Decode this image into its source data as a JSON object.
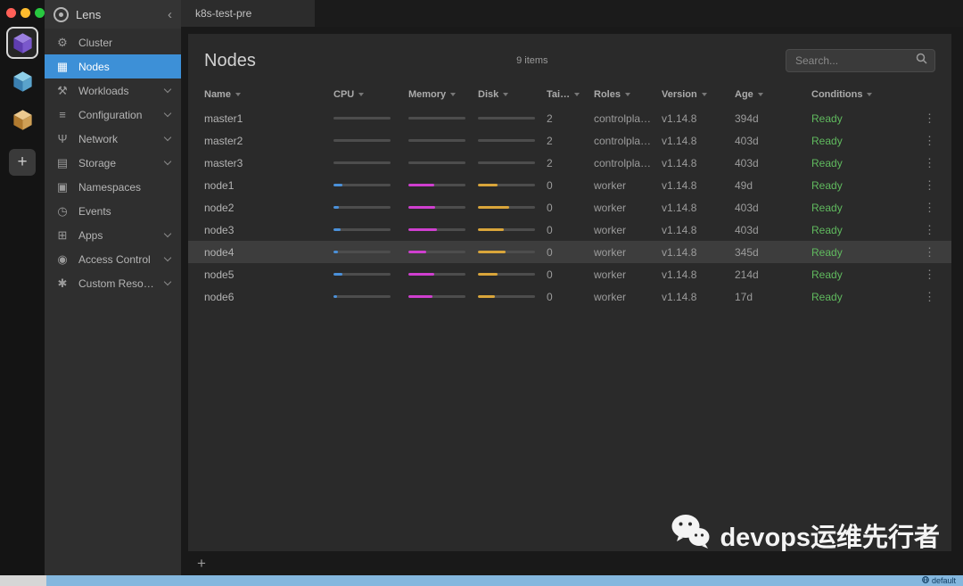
{
  "colors": {
    "accent_blue": "#3d90d7",
    "cpu_bar": "#4a90d9",
    "memory_bar": "#cf3fcf",
    "disk_bar": "#d9a53a",
    "ready_green": "#60ba5e",
    "statusbar_blue": "#84b7de"
  },
  "window": {
    "tab_label": "k8s-test-pre",
    "traffic_lights": [
      {
        "name": "close",
        "color": "#ff5f57"
      },
      {
        "name": "minimize",
        "color": "#febc2e"
      },
      {
        "name": "zoom",
        "color": "#28c840"
      }
    ]
  },
  "cluster_rail": {
    "clusters": [
      {
        "name": "cluster-purple",
        "active": true,
        "top": "#9b7fe0",
        "left": "#5f3db0",
        "right": "#7a58cc"
      },
      {
        "name": "cluster-blue",
        "active": false,
        "top": "#8ecfe8",
        "left": "#3a7fb0",
        "right": "#5aa3cc"
      },
      {
        "name": "cluster-orange",
        "active": false,
        "top": "#ecc98f",
        "left": "#b07a2f",
        "right": "#cf9f55"
      }
    ],
    "add_label": "+"
  },
  "sidebar": {
    "title": "Lens",
    "collapse_glyph": "‹",
    "items": [
      {
        "label": "Cluster",
        "icon": "cluster",
        "glyph": "⚙",
        "expandable": false,
        "active": false
      },
      {
        "label": "Nodes",
        "icon": "nodes",
        "glyph": "▦",
        "expandable": false,
        "active": true
      },
      {
        "label": "Workloads",
        "icon": "workloads",
        "glyph": "⚒",
        "expandable": true,
        "active": false
      },
      {
        "label": "Configuration",
        "icon": "configuration",
        "glyph": "≡",
        "expandable": true,
        "active": false
      },
      {
        "label": "Network",
        "icon": "network",
        "glyph": "Ψ",
        "expandable": true,
        "active": false
      },
      {
        "label": "Storage",
        "icon": "storage",
        "glyph": "▤",
        "expandable": true,
        "active": false
      },
      {
        "label": "Namespaces",
        "icon": "namespaces",
        "glyph": "▣",
        "expandable": false,
        "active": false
      },
      {
        "label": "Events",
        "icon": "events",
        "glyph": "◷",
        "expandable": false,
        "active": false
      },
      {
        "label": "Apps",
        "icon": "apps",
        "glyph": "⊞",
        "expandable": true,
        "active": false
      },
      {
        "label": "Access Control",
        "icon": "access-control",
        "glyph": "◉",
        "expandable": true,
        "active": false
      },
      {
        "label": "Custom Resources",
        "icon": "custom-resources",
        "glyph": "✱",
        "expandable": true,
        "active": false
      }
    ]
  },
  "main": {
    "title": "Nodes",
    "items_count": "9 items",
    "search_placeholder": "Search...",
    "table": {
      "row_menu_glyph": "⋮",
      "columns": [
        {
          "key": "name",
          "label": "Name"
        },
        {
          "key": "cpu",
          "label": "CPU"
        },
        {
          "key": "memory",
          "label": "Memory"
        },
        {
          "key": "disk",
          "label": "Disk"
        },
        {
          "key": "taints",
          "label": "Tai…"
        },
        {
          "key": "roles",
          "label": "Roles"
        },
        {
          "key": "version",
          "label": "Version"
        },
        {
          "key": "age",
          "label": "Age"
        },
        {
          "key": "conditions",
          "label": "Conditions"
        }
      ],
      "rows": [
        {
          "name": "master1",
          "cpu": null,
          "memory": null,
          "disk": null,
          "taints": "2",
          "roles": "controlplane…",
          "version": "v1.14.8",
          "age": "394d",
          "condition": "Ready",
          "highlighted": false
        },
        {
          "name": "master2",
          "cpu": null,
          "memory": null,
          "disk": null,
          "taints": "2",
          "roles": "controlplane…",
          "version": "v1.14.8",
          "age": "403d",
          "condition": "Ready",
          "highlighted": false
        },
        {
          "name": "master3",
          "cpu": null,
          "memory": null,
          "disk": null,
          "taints": "2",
          "roles": "controlplane…",
          "version": "v1.14.8",
          "age": "403d",
          "condition": "Ready",
          "highlighted": false
        },
        {
          "name": "node1",
          "cpu": 15,
          "memory": 45,
          "disk": 35,
          "taints": "0",
          "roles": "worker",
          "version": "v1.14.8",
          "age": "49d",
          "condition": "Ready",
          "highlighted": false
        },
        {
          "name": "node2",
          "cpu": 10,
          "memory": 47,
          "disk": 55,
          "taints": "0",
          "roles": "worker",
          "version": "v1.14.8",
          "age": "403d",
          "condition": "Ready",
          "highlighted": false
        },
        {
          "name": "node3",
          "cpu": 12,
          "memory": 50,
          "disk": 45,
          "taints": "0",
          "roles": "worker",
          "version": "v1.14.8",
          "age": "403d",
          "condition": "Ready",
          "highlighted": false
        },
        {
          "name": "node4",
          "cpu": 8,
          "memory": 32,
          "disk": 48,
          "taints": "0",
          "roles": "worker",
          "version": "v1.14.8",
          "age": "345d",
          "condition": "Ready",
          "highlighted": true
        },
        {
          "name": "node5",
          "cpu": 15,
          "memory": 45,
          "disk": 35,
          "taints": "0",
          "roles": "worker",
          "version": "v1.14.8",
          "age": "214d",
          "condition": "Ready",
          "highlighted": false
        },
        {
          "name": "node6",
          "cpu": 6,
          "memory": 42,
          "disk": 30,
          "taints": "0",
          "roles": "worker",
          "version": "v1.14.8",
          "age": "17d",
          "condition": "Ready",
          "highlighted": false
        }
      ]
    }
  },
  "dock": {
    "add_label": "+"
  },
  "statusbar": {
    "label": "default"
  },
  "watermark": {
    "text": "devops运维先行者"
  }
}
